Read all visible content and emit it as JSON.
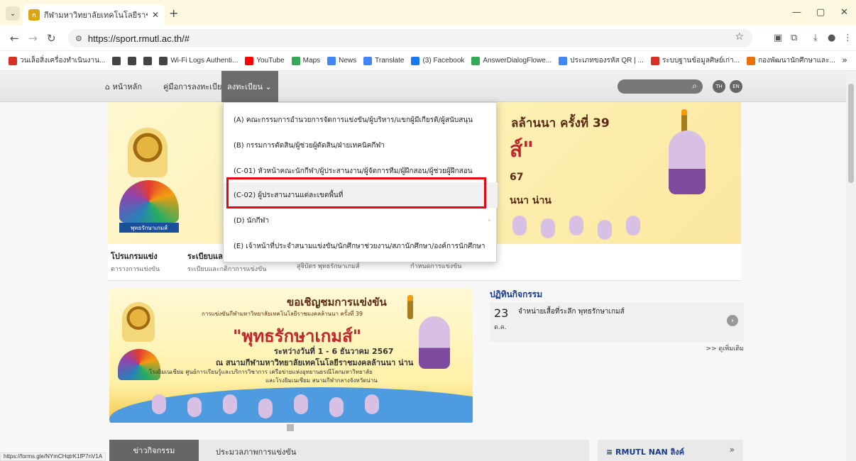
{
  "browser": {
    "tab_title": "กีฬามหาวิทยาลัยเทคโนโลยีราชมงคล",
    "url": "https://sport.rmutl.ac.th/#",
    "status_url": "https://forms.gle/NYmCHqtrK1fP7nV1A",
    "bookmarks": [
      {
        "label": "วนเล็อสิ่งเครื่องทำเนินงาน...",
        "color": "#d93025"
      },
      {
        "label": "",
        "color": "#444444"
      },
      {
        "label": "",
        "color": "#444444"
      },
      {
        "label": "",
        "color": "#444444"
      },
      {
        "label": "Wi-Fi Logs Authenti...",
        "color": "#444444"
      },
      {
        "label": "YouTube",
        "color": "#ff0000"
      },
      {
        "label": "Maps",
        "color": "#34a853"
      },
      {
        "label": "News",
        "color": "#4285f4"
      },
      {
        "label": "Translate",
        "color": "#4285f4"
      },
      {
        "label": "(3) Facebook",
        "color": "#1877f2"
      },
      {
        "label": "AnswerDialogFlowe...",
        "color": "#34a853"
      },
      {
        "label": "ประเภทของรหัส QR | ...",
        "color": "#4285f4"
      },
      {
        "label": "ระบบฐานข้อมูลศิษย์เก่า...",
        "color": "#d93025"
      },
      {
        "label": "กองพัฒนานักศึกษาและ...",
        "color": "#e8710a"
      }
    ]
  },
  "site_nav": {
    "home": "หน้าหลัก",
    "manual": "คู่มือการลงทะเบียน",
    "register": "ลงทะเบียน",
    "lang_th": "TH",
    "lang_en": "EN"
  },
  "dropdown": {
    "items": [
      "(A) คณะกรรมการอำนวยการจัดการแข่งขัน/ผู้บริหาร/แขกผู้มีเกียรติ/ผู้สนับสนุน",
      "(B) กรรมการตัดสิน/ผู้ช่วยผู้ตัดสิน/ฝ่ายเทคนิคกีฬา",
      "(C-01) หัวหน้าคณะนักกีฬา/ผู้ประสานงาน/ผู้จัดการทีม/ผู้ฝึกสอน/ผู้ช่วยผู้ฝึกสอน",
      "(C-02) ผู้ประสานงานแต่ละเขตพื้นที่",
      "(D) นักกีฬา",
      "(E) เจ้าหน้าที่ประจำสนามแข่งขัน/นักศึกษาช่วยงาน/สภานักศึกษา/องค์การนักศึกษา"
    ]
  },
  "hero": {
    "title1": "ลล้านนา ครั้งที่ 39",
    "title2": "ส์\"",
    "date": "67",
    "place": "นนา น่าน",
    "logo_tag": "พุทธรักษาเกมส์"
  },
  "tiles": [
    {
      "title": "โปรแกรมแข่ง",
      "sub": "ตารางการแข่งขัน"
    },
    {
      "title": "ระเบียบและ",
      "sub": "ระเบียบและกติกาการแข่งขัน"
    },
    {
      "title": "",
      "sub": "สูจิบัตร พุทธรักษาเกมส์"
    },
    {
      "title": "",
      "sub": "กำหนดการแข่งขัน"
    }
  ],
  "banner": {
    "line1": "ขอเชิญชมการแข่งขัน",
    "line2": "การแข่งขันกีฬามหาวิทยาลัยเทคโนโลยีราชมงคลล้านนา ครั้งที่ 39",
    "line3": "\"พุทธรักษาเกมส์\"",
    "line4": "ระหว่างวันที่ 1 - 6 ธันวาคม 2567",
    "line5": "ณ สนามกีฬามหาวิทยาลัยเทคโนโลยีราชมงคลล้านนา น่าน",
    "line6": "โรงยิมเนเซียม ศูนย์การเรียนรู้และบริการวิชาการ เครือข่ายแห่งอุทยานธรณีโลกมหาวิทยาลัย",
    "line7": "และโรงยิมเนเซียม สนามกีฬากลางจังหวัดน่าน"
  },
  "activity": {
    "title": "ปฏิทินกิจกรรม",
    "day": "23",
    "month": "ต.ค.",
    "text": "จำหน่ายเสื้อที่ระลึก พุทธรักษาเกมส์",
    "more": ">> ดูเพิ่มเติม"
  },
  "bottom": {
    "news_tab": "ข่าวกิจกรรม",
    "news_tab2": "ประมวลภาพการแข่งขัน",
    "link_label": "RMUTL NAN ลิงค์",
    "link_more": "»"
  },
  "colors": {
    "highlight_box": "#e30613",
    "nav_active": "#6c6c6c",
    "brand_red": "#c0272d"
  }
}
